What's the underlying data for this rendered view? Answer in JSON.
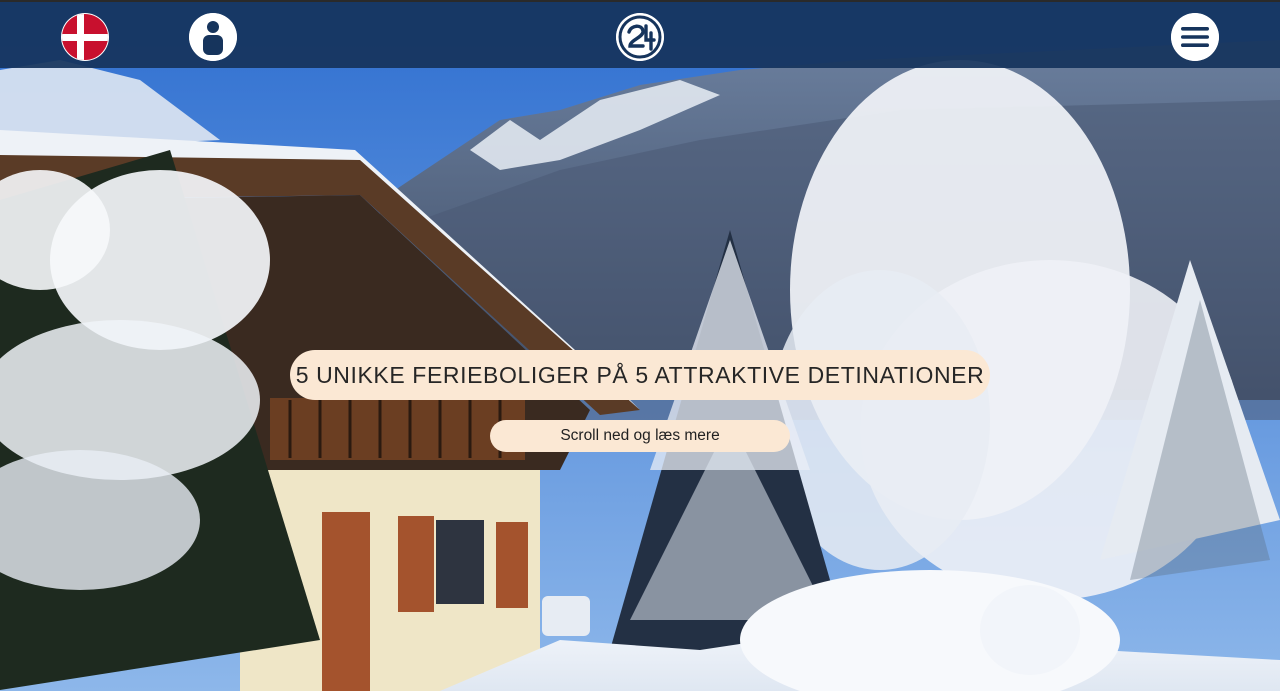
{
  "header": {
    "language_icon": "denmark-flag-icon",
    "account_icon": "user-icon",
    "logo_icon": "brand-logo-icon",
    "menu_icon": "hamburger-menu-icon",
    "bar_color": "#16345c"
  },
  "hero": {
    "headline": "5 UNIKKE FERIEBOLIGER PÅ 5 ATTRAKTIVE DETINATIONER",
    "scroll_label": "Scroll ned og læs mere",
    "pill_color": "#fbe8d4"
  }
}
